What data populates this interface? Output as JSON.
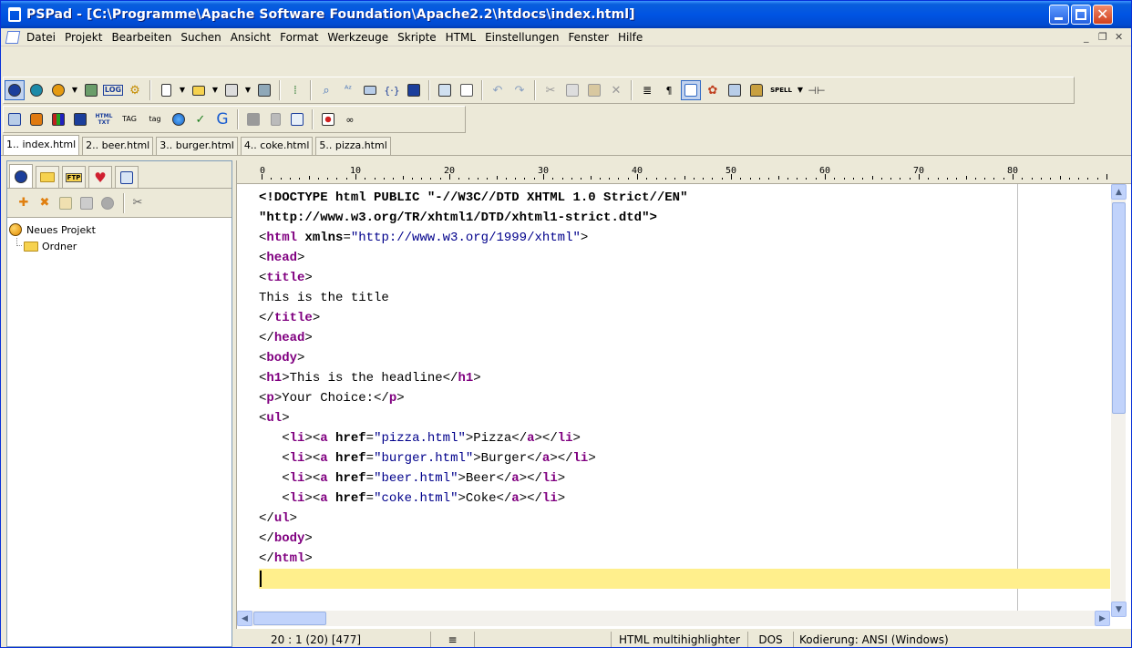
{
  "window": {
    "title": "PSPad - [C:\\Programme\\Apache Software Foundation\\Apache2.2\\htdocs\\index.html]",
    "buttons": {
      "minimize": "minimize-icon",
      "maximize": "maximize-icon",
      "close": "close-icon"
    }
  },
  "menu": [
    "Datei",
    "Projekt",
    "Bearbeiten",
    "Suchen",
    "Ansicht",
    "Format",
    "Werkzeuge",
    "Skripte",
    "HTML",
    "Einstellungen",
    "Fenster",
    "Hilfe"
  ],
  "mdi_controls": {
    "minimize": "_",
    "restore": "❐",
    "close": "✕"
  },
  "toolbar1_icons": [
    "project-icon",
    "open-project-icon",
    "save-project-icon",
    "dropdown-icon",
    "project-close-icon",
    "log-icon",
    "settings-icon",
    "new-file-icon",
    "dropdown-icon",
    "open-file-icon",
    "dropdown-icon",
    "save-icon",
    "dropdown-icon",
    "save-all-icon",
    "find-icon",
    "find-replace-icon",
    "spelling-icon",
    "code-icon",
    "columns-icon",
    "preview-icon",
    "print-icon",
    "undo-icon",
    "redo-icon",
    "cut-icon",
    "copy-icon",
    "paste-icon",
    "delete-icon",
    "word-wrap-icon",
    "pilcrow-icon",
    "line-numbers-icon",
    "colors-icon",
    "split-icon",
    "lock-icon",
    "spell-icon",
    "dropdown-icon",
    "pin-icon"
  ],
  "toolbar1_labels": {
    "log": "LOG",
    "spell": "SPELL"
  },
  "toolbar2_labels": {
    "html_txt": "HTML TXT",
    "tag1": "TAG",
    "tag2": "tag",
    "g": "G"
  },
  "tabs": [
    "1.. index.html",
    "2.. beer.html",
    "3.. burger.html",
    "4.. coke.html",
    "5.. pizza.html"
  ],
  "left_panel": {
    "tab_labels": {
      "ftp": "FTP"
    },
    "tree": [
      {
        "label": "Neues Projekt",
        "icon": "project-icon"
      },
      {
        "label": "Ordner",
        "icon": "folder-icon"
      }
    ]
  },
  "ruler": {
    "labels": [
      "0",
      "10",
      "20",
      "30",
      "40",
      "50",
      "60",
      "70",
      "80"
    ]
  },
  "code_lines": [
    "<!DOCTYPE html PUBLIC \"-//W3C//DTD XHTML 1.0 Strict//EN\"",
    "\"http://www.w3.org/TR/xhtml1/DTD/xhtml1-strict.dtd\">",
    "<html xmlns=\"http://www.w3.org/1999/xhtml\">",
    "<head>",
    "<title>",
    "This is the title",
    "</title>",
    "</head>",
    "<body>",
    "<h1>This is the headline</h1>",
    "<p>Your Choice:</p>",
    "<ul>",
    "   <li><a href=\"pizza.html\">Pizza</a></li>",
    "   <li><a href=\"burger.html\">Burger</a></li>",
    "   <li><a href=\"beer.html\">Beer</a></li>",
    "   <li><a href=\"coke.html\">Coke</a></li>",
    "</ul>",
    "</body>",
    "</html>",
    ""
  ],
  "status": {
    "position": "20 : 1  (20)  [477]",
    "highlighter": "HTML multihighlighter",
    "line_end": "DOS",
    "encoding": "Kodierung: ANSI (Windows)"
  },
  "colors": {
    "titlebar": "#0054e3",
    "current_line": "#ffef8c",
    "tag": "#800080",
    "attr_value": "#00008b"
  }
}
